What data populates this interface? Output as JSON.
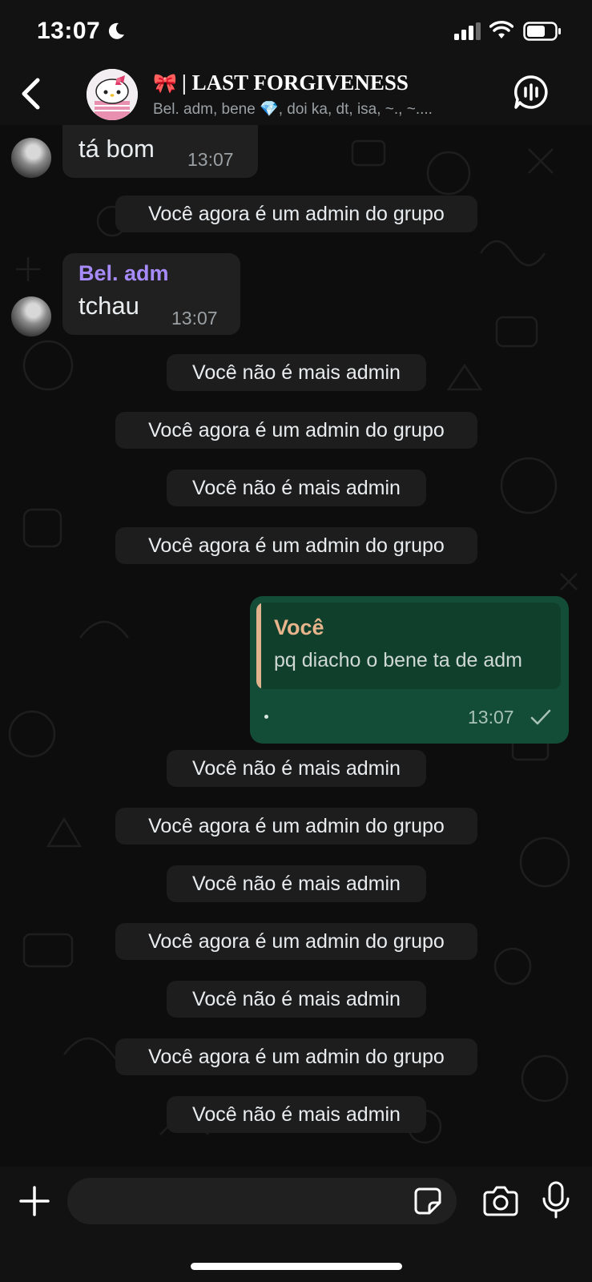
{
  "status_bar": {
    "time": "13:07"
  },
  "header": {
    "title_emoji": "🎀",
    "title": "| LAST FORGIVENESS",
    "subtitle": "Bel. adm, bene 💎, doi ka, dt, isa, ~., ~...."
  },
  "messages": {
    "m1": {
      "text": "tá bom",
      "time": "13:07"
    },
    "s1": "Você agora é um admin do grupo",
    "m2": {
      "sender": "Bel. adm",
      "text": "tchau",
      "time": "13:07"
    },
    "s2": "Você não é mais admin",
    "s3": "Você agora é um admin do grupo",
    "s4": "Você não é mais admin",
    "s5": "Você agora é um admin do grupo",
    "out1": {
      "quote_sender": "Você",
      "quote_text": "pq diacho o bene ta de adm",
      "time": "13:07"
    },
    "s6": "Você não é mais admin",
    "s7": "Você agora é um admin do grupo",
    "s8": "Você não é mais admin",
    "s9": "Você agora é um admin do grupo",
    "s10": "Você não é mais admin",
    "s11": "Você agora é um admin do grupo",
    "s12": "Você não é mais admin"
  },
  "input": {
    "value": "",
    "placeholder": ""
  },
  "colors": {
    "background": "#0d0d0d",
    "incoming_bubble": "#202020",
    "outgoing_bubble": "#144d37",
    "sender_name": "#a78bfa",
    "quote_accent": "#e8b48c"
  },
  "icons": [
    "moon-icon",
    "signal-icon",
    "wifi-icon",
    "battery-icon",
    "back-chevron-icon",
    "voice-chat-icon",
    "plus-icon",
    "sticker-icon",
    "camera-icon",
    "microphone-icon",
    "checkmark-icon"
  ]
}
